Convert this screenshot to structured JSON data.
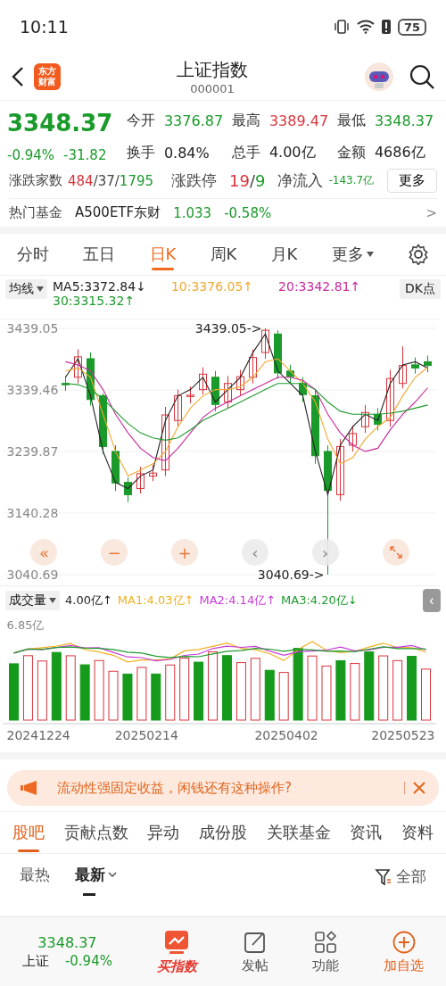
{
  "status_bar": {
    "time": "10:11",
    "battery": "75"
  },
  "header": {
    "title": "上证指数",
    "code": "000001",
    "logo_lines": [
      "东方",
      "财富"
    ]
  },
  "quote": {
    "price": "3348.37",
    "change_pct": "-0.94%",
    "change": "-31.82",
    "stats": [
      {
        "label": "今开",
        "value": "3376.87",
        "color": "#1a9a2a"
      },
      {
        "label": "最高",
        "value": "3389.47",
        "color": "#d8343c"
      },
      {
        "label": "最低",
        "value": "3348.37",
        "color": "#1a9a2a"
      },
      {
        "label": "换手",
        "value": "0.84%",
        "color": "#222222"
      },
      {
        "label": "总手",
        "value": "4.00亿",
        "color": "#222222"
      },
      {
        "label": "金额",
        "value": "4686亿",
        "color": "#222222"
      }
    ],
    "breadth": {
      "label": "涨跌家数",
      "up": "484",
      "flat": "37",
      "down": "1795",
      "separator": "/"
    },
    "limit": {
      "label": "涨跌停",
      "up": "19",
      "down": "9",
      "separator": "/"
    },
    "inflow": {
      "label": "净流入",
      "value": "-143.7亿"
    },
    "more_button": "更多"
  },
  "hot_fund": {
    "label": "热门基金",
    "name": "A500ETF东财",
    "price": "1.033",
    "change": "-0.58%",
    "chevron": ">"
  },
  "period_tabs": [
    {
      "label": "分时",
      "selected": false
    },
    {
      "label": "五日",
      "selected": false
    },
    {
      "label": "日K",
      "selected": true
    },
    {
      "label": "周K",
      "selected": false
    },
    {
      "label": "月K",
      "selected": false
    },
    {
      "label": "更多",
      "selected": false,
      "dropdown": true
    }
  ],
  "kline": {
    "indicator": "均线",
    "dk_button": "DK点",
    "legend": [
      {
        "text": "MA5:3372.84↓",
        "color": "#222222"
      },
      {
        "text": "10:3376.05↑",
        "color": "#f0a830"
      },
      {
        "text": "20:3342.81↑",
        "color": "#c8289c"
      },
      {
        "text": "30:3315.32↑",
        "color": "#1f9a2e"
      }
    ],
    "chart_controls": [
      "«",
      "−",
      "+",
      "‹",
      "›"
    ],
    "chart_data": {
      "type": "candlestick",
      "grid": true,
      "ylim": [
        3040.69,
        3439.05
      ],
      "categories": [
        null,
        null,
        null,
        null,
        null,
        null,
        null,
        null,
        null,
        null,
        null,
        null,
        null,
        null,
        null,
        null,
        null,
        null,
        null,
        null,
        null,
        null,
        null,
        null,
        null,
        null,
        null,
        null,
        null,
        null
      ],
      "ohlc": [
        [
          3350,
          3362,
          3338,
          3349
        ],
        [
          3360,
          3405,
          3350,
          3393
        ],
        [
          3390,
          3400,
          3314,
          3324
        ],
        [
          3330,
          3334,
          3236,
          3248
        ],
        [
          3240,
          3250,
          3176,
          3189
        ],
        [
          3190,
          3198,
          3158,
          3170
        ],
        [
          3180,
          3215,
          3172,
          3204
        ],
        [
          3200,
          3218,
          3192,
          3205
        ],
        [
          3210,
          3312,
          3200,
          3299
        ],
        [
          3290,
          3340,
          3280,
          3330
        ],
        [
          3330,
          3345,
          3318,
          3331
        ],
        [
          3340,
          3376,
          3332,
          3365
        ],
        [
          3360,
          3370,
          3305,
          3316
        ],
        [
          3320,
          3362,
          3310,
          3350
        ],
        [
          3340,
          3372,
          3330,
          3361
        ],
        [
          3360,
          3405,
          3350,
          3392
        ],
        [
          3400,
          3439.05,
          3390,
          3436
        ],
        [
          3430,
          3436,
          3357,
          3367
        ],
        [
          3370,
          3380,
          3350,
          3361
        ],
        [
          3350,
          3360,
          3320,
          3332
        ],
        [
          3330,
          3340,
          3220,
          3233
        ],
        [
          3240,
          3250,
          3040.69,
          3177
        ],
        [
          3170,
          3260,
          3160,
          3248
        ],
        [
          3250,
          3282,
          3240,
          3269
        ],
        [
          3280,
          3315,
          3270,
          3303
        ],
        [
          3300,
          3310,
          3274,
          3284
        ],
        [
          3290,
          3372,
          3280,
          3358
        ],
        [
          3350,
          3410,
          3342,
          3379
        ],
        [
          3380,
          3392,
          3366,
          3375
        ],
        [
          3385,
          3395,
          3368,
          3379
        ]
      ],
      "yticks": [
        {
          "value": 3439.05,
          "label": "3439.05"
        },
        {
          "value": 3339.46,
          "label": "3339.46"
        },
        {
          "value": 3239.87,
          "label": "3239.87"
        },
        {
          "value": 3140.28,
          "label": "3140.28"
        },
        {
          "value": 3040.69,
          "label": "3040.69"
        }
      ],
      "series": [
        {
          "type": "line",
          "color": "#222222",
          "values": [
            3360,
            3390,
            3330,
            3240,
            3190,
            3180,
            3200,
            3210,
            3290,
            3330,
            3340,
            3360,
            3320,
            3340,
            3360,
            3400,
            3430,
            3370,
            3350,
            3330,
            3240,
            3170,
            3250,
            3280,
            3300,
            3290,
            3350,
            3380,
            3385,
            3375
          ]
        },
        {
          "type": "line",
          "color": "#f0a830",
          "values": [
            3370,
            3375,
            3360,
            3300,
            3240,
            3200,
            3210,
            3220,
            3240,
            3280,
            3310,
            3330,
            3340,
            3340,
            3345,
            3360,
            3385,
            3390,
            3370,
            3350,
            3320,
            3260,
            3220,
            3230,
            3260,
            3280,
            3295,
            3330,
            3360,
            3376
          ]
        },
        {
          "type": "line",
          "color": "#c8289c",
          "values": [
            3385,
            3380,
            3370,
            3340,
            3300,
            3270,
            3245,
            3230,
            3225,
            3245,
            3270,
            3295,
            3310,
            3320,
            3330,
            3340,
            3350,
            3360,
            3360,
            3355,
            3340,
            3300,
            3270,
            3250,
            3240,
            3245,
            3275,
            3300,
            3320,
            3343
          ]
        },
        {
          "type": "line",
          "color": "#1f9a2e",
          "values": [
            3350,
            3348,
            3340,
            3325,
            3305,
            3285,
            3270,
            3262,
            3258,
            3262,
            3275,
            3290,
            3300,
            3310,
            3320,
            3330,
            3340,
            3350,
            3350,
            3350,
            3340,
            3320,
            3305,
            3300,
            3300,
            3300,
            3302,
            3305,
            3310,
            3315
          ]
        }
      ],
      "annotations": [
        "3439.05->",
        "3040.69->"
      ]
    }
  },
  "volume": {
    "indicator": "成交量",
    "current": "4.00亿↑",
    "legend": [
      {
        "text": "MA1:4.03亿↑",
        "color": "#f0b020"
      },
      {
        "text": "MA2:4.14亿↑",
        "color": "#c83cd8"
      },
      {
        "text": "MA3:4.20亿↓",
        "color": "#1f9a2e"
      }
    ],
    "collapse": "‹",
    "scale_label": "6.85亿",
    "dates": [
      "20241224",
      "20250214",
      "20250402",
      "20250523"
    ]
  },
  "ad_banner": {
    "text": "流动性强固定收益，闲钱还有这种操作?"
  },
  "content_tabs": [
    {
      "label": "股吧",
      "selected": true
    },
    {
      "label": "贡献点数",
      "selected": false
    },
    {
      "label": "异动",
      "selected": false
    },
    {
      "label": "成份股",
      "selected": false
    },
    {
      "label": "关联基金",
      "selected": false
    },
    {
      "label": "资讯",
      "selected": false
    },
    {
      "label": "资料",
      "selected": false
    }
  ],
  "sort": {
    "options": [
      {
        "label": "最热",
        "selected": false
      },
      {
        "label": "最新",
        "selected": true,
        "dropdown": true
      }
    ],
    "filter": "全部"
  },
  "bottom_bar": [
    {
      "kind": "quote",
      "price": "3348.37",
      "name": "上证",
      "change": "-0.94%"
    },
    {
      "kind": "promo",
      "label": "买指数"
    },
    {
      "kind": "post",
      "label": "发帖"
    },
    {
      "kind": "tools",
      "label": "功能"
    },
    {
      "kind": "add",
      "label": "加自选"
    }
  ]
}
